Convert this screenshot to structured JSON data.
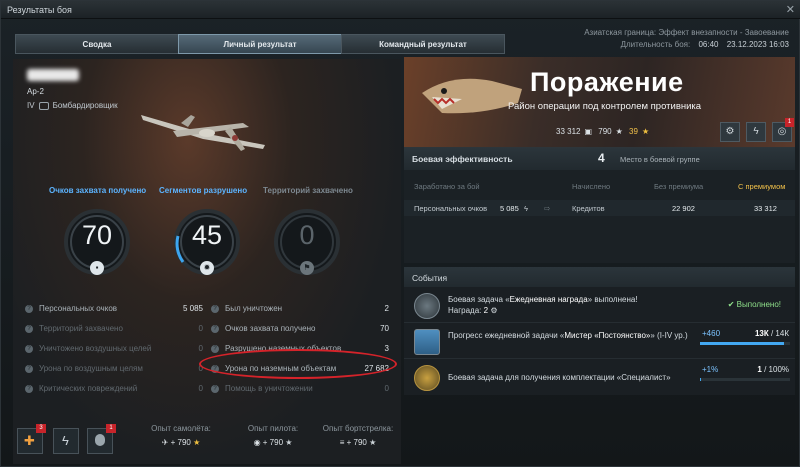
{
  "window": {
    "title": "Результаты боя",
    "close": "✕"
  },
  "tabs": [
    {
      "label": "Сводка"
    },
    {
      "label": "Личный результат"
    },
    {
      "label": "Командный результат"
    }
  ],
  "meta": {
    "mode": "Азиатская граница: Эффект внезапности - Завоевание",
    "duration_label": "Длительность боя:",
    "duration": "06:40",
    "datetime": "23.12.2023 16:03"
  },
  "plane": {
    "name": "Ар-2",
    "tier": "IV",
    "type": "Бомбардировщик"
  },
  "capture": {
    "headers": [
      "Очков захвата получено",
      "Сегментов разрушено",
      "Территорий захвачено"
    ],
    "values": [
      "70",
      "45",
      "0"
    ]
  },
  "stats_left": [
    {
      "label": "Персональных очков",
      "value": "5 085"
    },
    {
      "label": "Территорий захвачено",
      "value": "0"
    },
    {
      "label": "Уничтожено воздушных целей",
      "value": "0"
    },
    {
      "label": "Урона по воздушным целям",
      "value": "0"
    },
    {
      "label": "Критических повреждений",
      "value": "0"
    }
  ],
  "stats_right": [
    {
      "label": "Был уничтожен",
      "value": "2"
    },
    {
      "label": "Очков захвата получено",
      "value": "70"
    },
    {
      "label": "Разрушено наземных объектов",
      "value": "3"
    },
    {
      "label": "Урона по наземным объектам",
      "value": "27 682"
    },
    {
      "label": "Помощь в уничтожении",
      "value": "0"
    }
  ],
  "bottom": {
    "badges": [
      "3",
      "1"
    ],
    "plane_exp_label": "Опыт самолёта:",
    "plane_exp": "+ 790",
    "pilot_exp_label": "Опыт пилота:",
    "pilot_exp": "+ 790",
    "gunner_exp_label": "Опыт бортстрелка:",
    "gunner_exp": "+ 790"
  },
  "result": {
    "title": "Поражение",
    "subtitle": "Район операции под контролем противника",
    "credits": "33 312",
    "exp": "790",
    "gold": "39",
    "badge": "1"
  },
  "efficiency": {
    "title": "Боевая эффективность",
    "place": "4",
    "place_label": "Место в боевой группе",
    "col_earned": "Заработано за бой",
    "col_start": "Начислено",
    "col_nopremium": "Без премиума",
    "col_premium": "С премиумом",
    "row_label": "Персональных очков",
    "row_points": "5 085",
    "row_currency": "Кредитов",
    "row_nopremium": "22 902",
    "row_premium": "33 312"
  },
  "events": {
    "title": "События",
    "items": [
      {
        "pre": "Боевая задача «",
        "name": "Ежедневная награда",
        "post": "» выполнена!",
        "reward_label": "Награда:",
        "reward": "2",
        "status": "✔ Выполнено!"
      },
      {
        "pre": "Прогресс ежедневной задачи «",
        "name": "Мистер «Постоянство»",
        "post": "» (I-IV ур.)",
        "delta": "+460",
        "progress": "13К",
        "total": "/ 14К",
        "fraction": 0.93
      },
      {
        "text": "Боевая задача для получения комплектации «Специалист»",
        "delta": "+1%",
        "progress": "1",
        "total": "/ 100%",
        "fraction": 0.01
      }
    ]
  }
}
